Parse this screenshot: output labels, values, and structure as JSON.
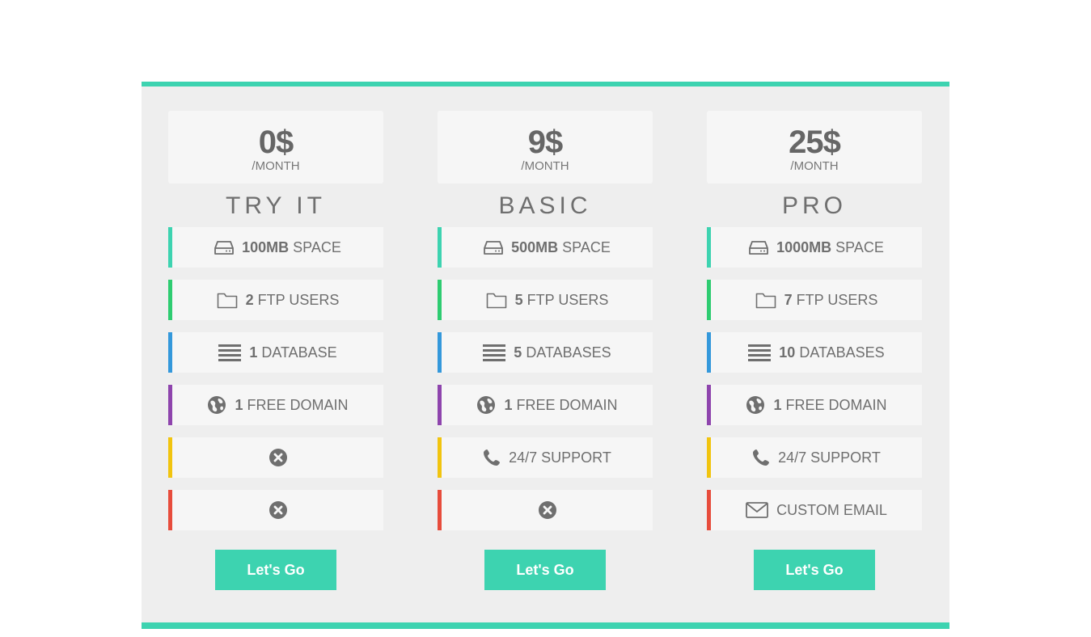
{
  "accent_color": "#3dd3b0",
  "feature_colors": [
    "#3dd3b0",
    "#2ecc71",
    "#3498db",
    "#8e44ad",
    "#f1c40f",
    "#e74c3c"
  ],
  "plans": [
    {
      "price": "0$",
      "period": "/MONTH",
      "name": "TRY IT",
      "space_value": "100MB",
      "space_label": "SPACE",
      "ftp_value": "2",
      "ftp_label": "FTP USERS",
      "db_value": "1",
      "db_label": "DATABASE",
      "domain_value": "1",
      "domain_label": "FREE DOMAIN",
      "support": null,
      "email": null,
      "cta_label": "Let's Go"
    },
    {
      "price": "9$",
      "period": "/MONTH",
      "name": "BASIC",
      "space_value": "500MB",
      "space_label": "SPACE",
      "ftp_value": "5",
      "ftp_label": "FTP USERS",
      "db_value": "5",
      "db_label": "DATABASES",
      "domain_value": "1",
      "domain_label": "FREE DOMAIN",
      "support": "24/7 SUPPORT",
      "email": null,
      "cta_label": "Let's Go"
    },
    {
      "price": "25$",
      "period": "/MONTH",
      "name": "PRO",
      "space_value": "1000MB",
      "space_label": "SPACE",
      "ftp_value": "7",
      "ftp_label": "FTP USERS",
      "db_value": "10",
      "db_label": "DATABASES",
      "domain_value": "1",
      "domain_label": "FREE DOMAIN",
      "support": "24/7 SUPPORT",
      "email": "CUSTOM EMAIL",
      "cta_label": "Let's Go"
    }
  ]
}
